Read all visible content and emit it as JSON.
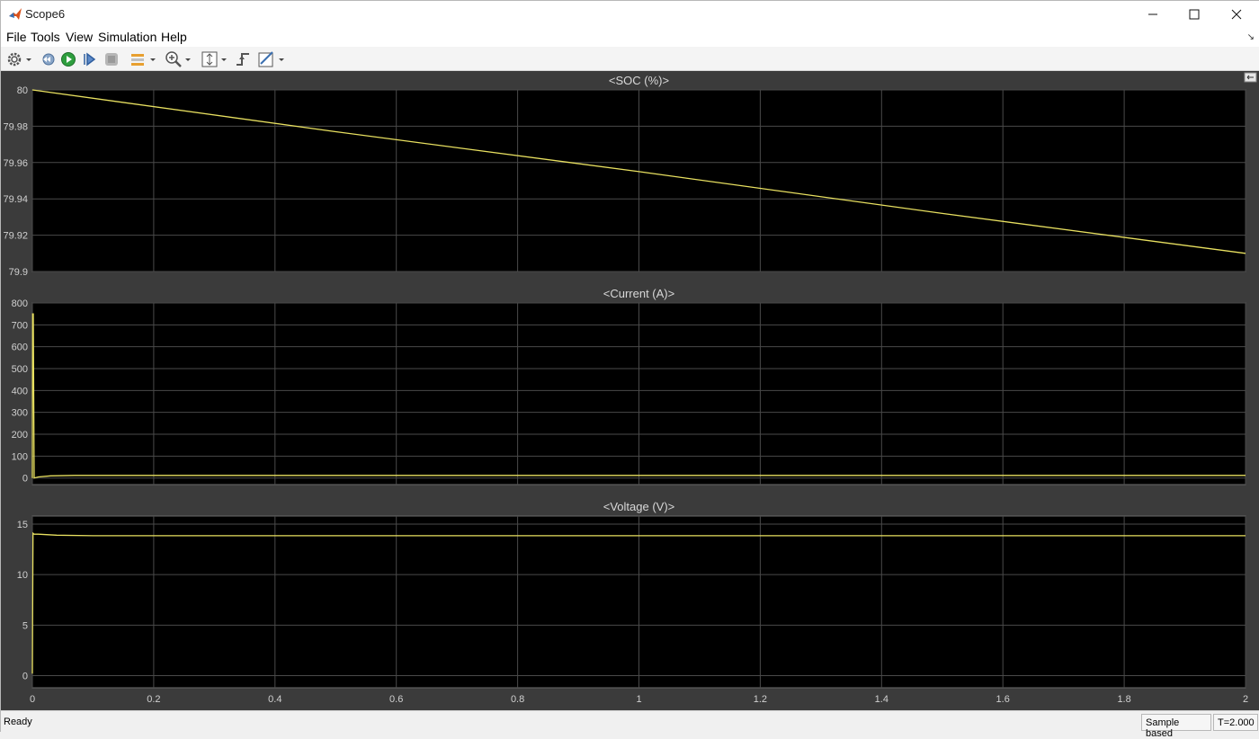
{
  "window": {
    "title": "Scope6"
  },
  "menu": [
    "File",
    "Tools",
    "View",
    "Simulation",
    "Help"
  ],
  "toolbar_icons": [
    "settings-gear-icon",
    "dropdown-arrow-icon",
    "step-back-icon",
    "run-icon",
    "step-forward-icon",
    "stop-icon",
    "signal-highlight-icon",
    "dropdown-arrow-icon",
    "zoom-in-icon",
    "dropdown-arrow-icon",
    "scale-axes-icon",
    "dropdown-arrow-icon",
    "triggers-icon",
    "measurements-icon",
    "dropdown-arrow-icon"
  ],
  "colors": {
    "plot_bg": "#000000",
    "frame_bg": "#3b3b3b",
    "grid": "#4a4a4a",
    "trace": "#e8e060",
    "text": "#d0d0d0"
  },
  "status": {
    "text": "Ready",
    "mode": "Sample based",
    "time": "T=2.000"
  },
  "chart_data": [
    {
      "type": "line",
      "title": "<SOC (%)>",
      "xlim": [
        0,
        2
      ],
      "ylim": [
        79.9,
        80.0
      ],
      "xticks": [
        0,
        0.2,
        0.4,
        0.6,
        0.8,
        1,
        1.2,
        1.4,
        1.6,
        1.8,
        2
      ],
      "xtick_labels": [],
      "yticks": [
        79.9,
        79.92,
        79.94,
        79.96,
        79.98,
        80
      ],
      "ytick_labels": [
        "79.9",
        "79.92",
        "79.94",
        "79.96",
        "79.98",
        "80"
      ],
      "grid": true,
      "series": [
        {
          "x": [
            0,
            0.5,
            1.0,
            1.5,
            2.0
          ],
          "y": [
            80.0,
            79.977,
            79.955,
            79.932,
            79.91
          ]
        }
      ]
    },
    {
      "type": "line",
      "title": "<Current (A)>",
      "xlim": [
        0,
        2
      ],
      "ylim": [
        -30,
        800
      ],
      "xticks": [
        0,
        0.2,
        0.4,
        0.6,
        0.8,
        1,
        1.2,
        1.4,
        1.6,
        1.8,
        2
      ],
      "xtick_labels": [],
      "yticks": [
        0,
        100,
        200,
        300,
        400,
        500,
        600,
        700,
        800
      ],
      "ytick_labels": [
        "0",
        "100",
        "200",
        "300",
        "400",
        "500",
        "600",
        "700",
        "800"
      ],
      "grid": true,
      "series": [
        {
          "x": [
            0,
            0.0005,
            0.0015,
            0.003,
            0.01,
            0.03,
            0.07,
            0.2,
            1.0,
            2.0
          ],
          "y": [
            0,
            750,
            750,
            0,
            5,
            10,
            12,
            12,
            12,
            12
          ]
        }
      ]
    },
    {
      "type": "line",
      "title": "<Voltage (V)>",
      "xlim": [
        0,
        2
      ],
      "ylim": [
        -1.2,
        15.8
      ],
      "xticks": [
        0,
        0.2,
        0.4,
        0.6,
        0.8,
        1,
        1.2,
        1.4,
        1.6,
        1.8,
        2
      ],
      "xtick_labels": [
        "0",
        "0.2",
        "0.4",
        "0.6",
        "0.8",
        "1",
        "1.2",
        "1.4",
        "1.6",
        "1.8",
        "2"
      ],
      "yticks": [
        0,
        5,
        10,
        15
      ],
      "ytick_labels": [
        "0",
        "5",
        "10",
        "15"
      ],
      "grid": true,
      "series": [
        {
          "x": [
            0,
            0.001,
            0.003,
            0.01,
            0.04,
            0.1,
            1.0,
            2.0
          ],
          "y": [
            0.2,
            14.1,
            14.0,
            14.0,
            13.9,
            13.85,
            13.85,
            13.85
          ]
        }
      ]
    }
  ]
}
